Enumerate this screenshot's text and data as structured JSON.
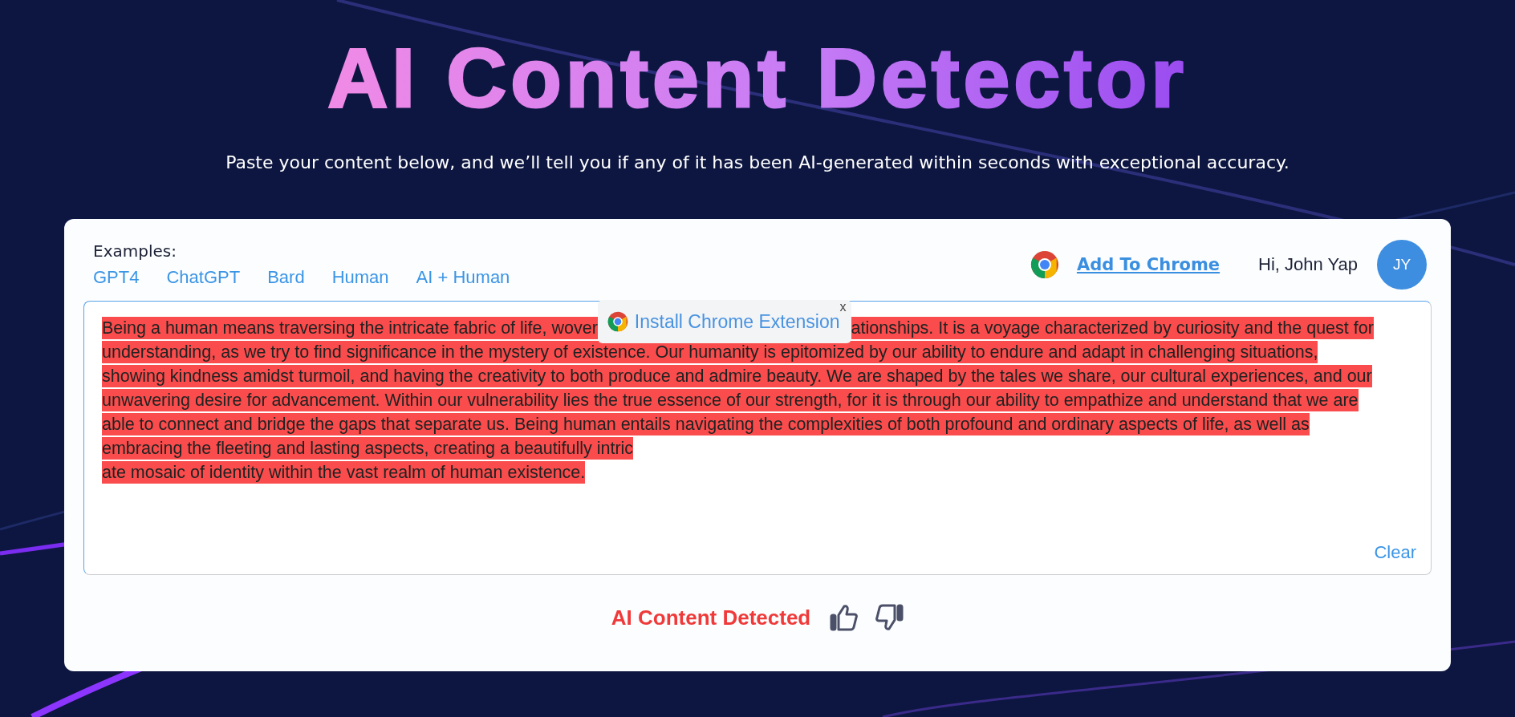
{
  "header": {
    "title": "AI Content Detector",
    "subtitle": "Paste your content below, and we’ll tell you if any of it has been AI-generated within seconds with exceptional accuracy."
  },
  "examples": {
    "label": "Examples:",
    "links": [
      "GPT4",
      "ChatGPT",
      "Bard",
      "Human",
      "AI + Human"
    ]
  },
  "chrome": {
    "link": "Add To Chrome"
  },
  "user": {
    "greeting": "Hi, John Yap",
    "initials": "JY"
  },
  "editor": {
    "popup": {
      "label": "Install Chrome Extension",
      "close": "x"
    },
    "lines": [
      {
        "highlighted": true,
        "segments": [
          "Being a human means traversing the intricate fabric of life, wover",
          "ationships. It is a voyage characterized by curiosity and the quest for"
        ]
      },
      {
        "highlighted": true,
        "segments": [
          "understanding, as we try to find significance in the mystery of existence. Our humanity is epitomized by our ability to endure and adapt in challenging situations,"
        ]
      },
      {
        "highlighted": true,
        "segments": [
          "showing kindness amidst turmoil, and having the creativity to both produce and admire beauty. We are shaped by the tales we share, our cultural experiences, and our"
        ]
      },
      {
        "highlighted": true,
        "segments": [
          "unwavering desire for advancement. Within our vulnerability lies the true essence of our strength, for it is through our ability to empathize and understand that we are"
        ]
      },
      {
        "highlighted": true,
        "segments": [
          "able to connect and bridge the gaps that separate us. Being human entails navigating the complexities of both profound and ordinary aspects of life, as well as"
        ]
      },
      {
        "highlighted": true,
        "segments": [
          "embracing the fleeting and lasting aspects, creating a beautifully intric"
        ]
      },
      {
        "highlighted": true,
        "segments": [
          "ate mosaic of identity within the vast realm of human existence."
        ]
      }
    ],
    "clear": "Clear"
  },
  "result": {
    "label": "AI Content Detected"
  }
}
